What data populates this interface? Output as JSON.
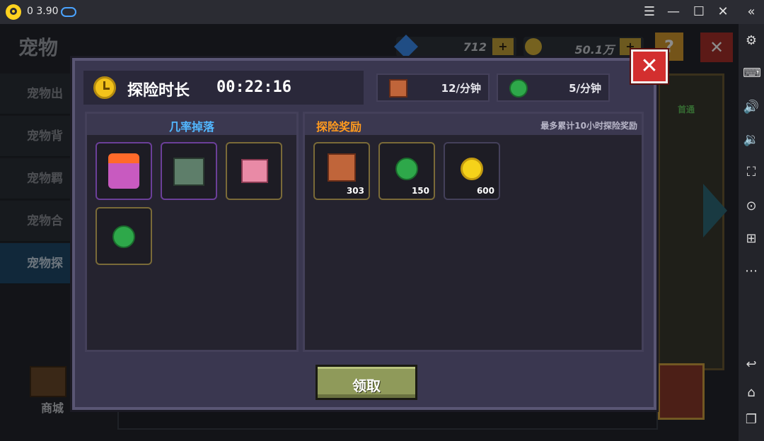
{
  "titlebar": {
    "app_version": "0 3.90"
  },
  "background": {
    "page_title": "宠物",
    "currency_gems": "712",
    "currency_coins": "50.1万",
    "tabs": [
      "宠物出",
      "宠物背",
      "宠物羁",
      "宠物合",
      "宠物探"
    ],
    "shop_label": "商城",
    "first_clear_label": "首通"
  },
  "dialog": {
    "title": "探险时长",
    "timer": "00:22:16",
    "rate_meat": "12/分钟",
    "rate_gem": "5/分钟",
    "drop_title": "几率掉落",
    "reward_title": "探险奖励",
    "reward_note": "最多累计10小时探险奖励",
    "reward_qty": [
      "303",
      "150",
      "600"
    ],
    "claim_label": "领取"
  },
  "colors": {
    "accent_orange": "#ff9a1f",
    "accent_blue": "#52b7ff",
    "close_red": "#d32f2f",
    "claim_green": "#8f9a5a"
  }
}
